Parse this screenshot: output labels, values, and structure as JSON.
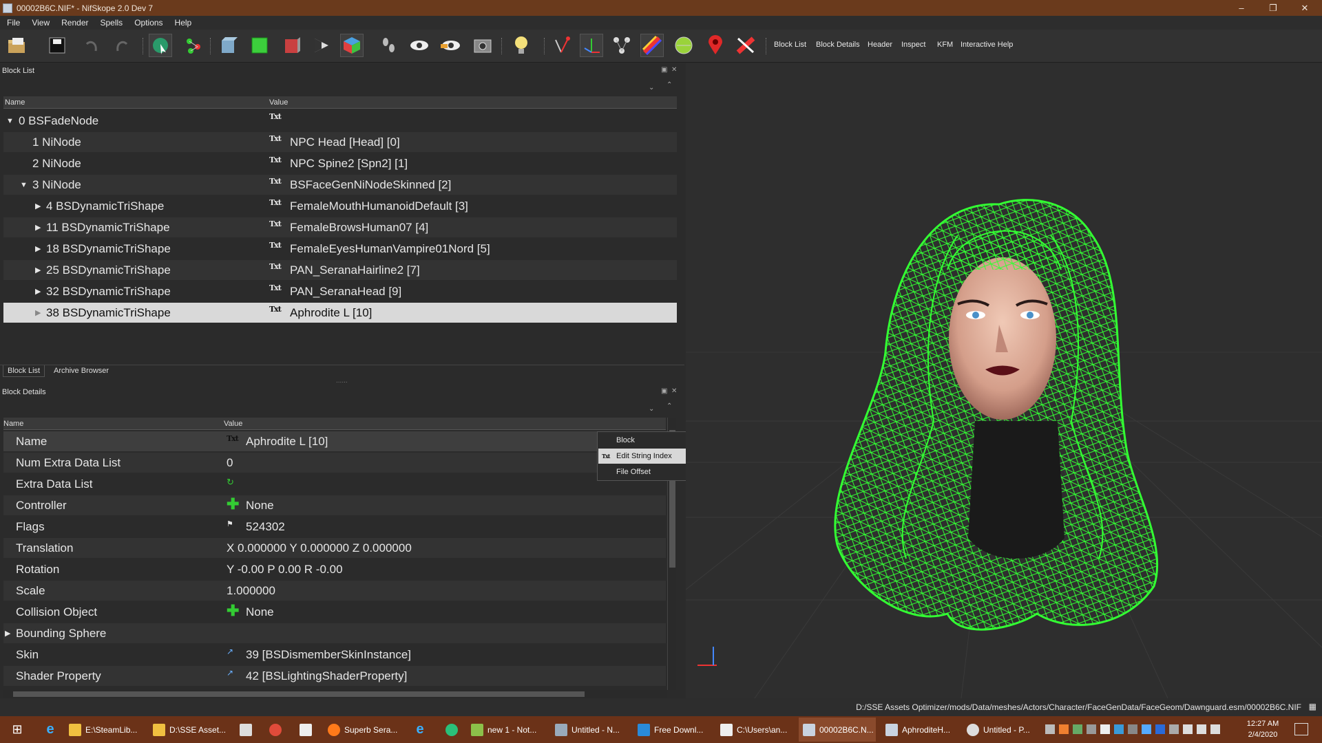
{
  "window": {
    "title": "00002B6C.NIF* - NifSkope 2.0 Dev 7"
  },
  "menu": [
    "File",
    "View",
    "Render",
    "Spells",
    "Options",
    "Help"
  ],
  "toolbar": {
    "icons": [
      "open-icon",
      "save-icon",
      "undo-icon",
      "redo-icon",
      "select-icon",
      "transform-icon",
      "view-front-icon",
      "view-side-icon",
      "view-box-icon",
      "view-flip-icon",
      "view-cube-icon",
      "footprints-icon",
      "eye-icon",
      "eye-hide-icon",
      "screenshot-icon",
      "light-icon",
      "node-pick-icon",
      "axes-icon",
      "nodes-tree-icon",
      "color-stripes-icon",
      "sphere-icon",
      "marker-icon",
      "no-texture-icon"
    ],
    "text_buttons": [
      "Block List",
      "Block Details",
      "Header",
      "Inspect",
      "KFM",
      "Interactive Help"
    ]
  },
  "block_list": {
    "title": "Block List",
    "columns": [
      "Name",
      "Value"
    ],
    "rows": [
      {
        "name": "0 BSFadeNode",
        "value": ""
      },
      {
        "name": "1 NiNode",
        "value": "NPC Head [Head] [0]"
      },
      {
        "name": "2 NiNode",
        "value": "NPC Spine2 [Spn2] [1]"
      },
      {
        "name": "3 NiNode",
        "value": "BSFaceGenNiNodeSkinned [2]"
      },
      {
        "name": "4 BSDynamicTriShape",
        "value": "FemaleMouthHumanoidDefault [3]"
      },
      {
        "name": "11 BSDynamicTriShape",
        "value": "FemaleBrowsHuman07 [4]"
      },
      {
        "name": "18 BSDynamicTriShape",
        "value": "FemaleEyesHumanVampire01Nord [5]"
      },
      {
        "name": "25 BSDynamicTriShape",
        "value": "PAN_SeranaHairline2 [7]"
      },
      {
        "name": "32 BSDynamicTriShape",
        "value": "PAN_SeranaHead [9]"
      },
      {
        "name": "38 BSDynamicTriShape",
        "value": "Aphrodite L [10]"
      }
    ],
    "tabs": [
      "Block List",
      "Archive Browser"
    ]
  },
  "block_details": {
    "title": "Block Details",
    "columns": [
      "Name",
      "Value"
    ],
    "rows": [
      {
        "name": "Name",
        "value": "Aphrodite L [10]"
      },
      {
        "name": "Num Extra Data List",
        "value": "0"
      },
      {
        "name": "Extra Data List",
        "value": ""
      },
      {
        "name": "Controller",
        "value": "None"
      },
      {
        "name": "Flags",
        "value": "524302"
      },
      {
        "name": "Translation",
        "value": "X 0.000000 Y 0.000000 Z 0.000000"
      },
      {
        "name": "Rotation",
        "value": "Y -0.00 P 0.00 R -0.00"
      },
      {
        "name": "Scale",
        "value": "1.000000"
      },
      {
        "name": "Collision Object",
        "value": "None"
      },
      {
        "name": "Bounding Sphere",
        "value": ""
      },
      {
        "name": "Skin",
        "value": "39 [BSDismemberSkinInstance]"
      },
      {
        "name": "Shader Property",
        "value": "42 [BSLightingShaderProperty]"
      }
    ]
  },
  "context_menu": {
    "items": [
      "Block",
      "Edit String Index",
      "File Offset"
    ],
    "txt_icon": "Txt"
  },
  "status": {
    "path": "D:/SSE Assets Optimizer/mods/Data/meshes/Actors/Character/FaceGenData/FaceGeom/Dawnguard.esm/00002B6C.NIF"
  },
  "taskbar": {
    "items": [
      "E:\\SteamLib...",
      "D:\\SSE Asset...",
      "Superb Sera...",
      "new 1 - Not...",
      "Untitled - N...",
      "Free Downl...",
      "C:\\Users\\an...",
      "00002B6C.N...",
      "AphroditeH...",
      "Untitled - P..."
    ],
    "time": "12:27 AM",
    "date": "2/4/2020"
  },
  "colors": {
    "title_bar": "#6a3a1c",
    "taskbar": "#6b3218",
    "wireframe": "#33ff33",
    "selection": "#d9d9d9"
  }
}
